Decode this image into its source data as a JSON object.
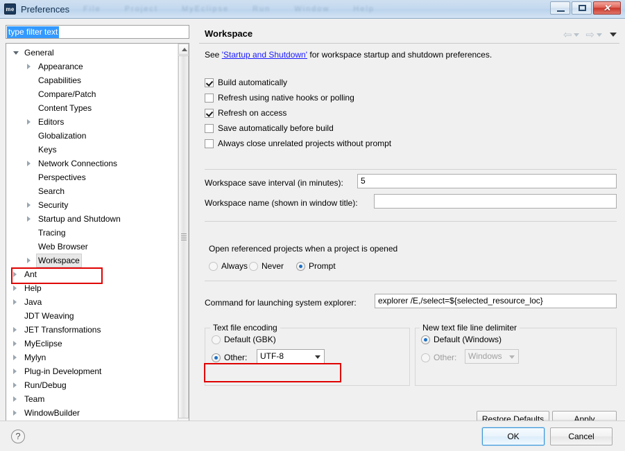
{
  "window": {
    "title": "Preferences",
    "app_icon_text": "me",
    "background_menu_ghost": [
      "File",
      "Project",
      "MyEclipse",
      "Run",
      "Window",
      "Help"
    ],
    "controls": {
      "minimize": "minimize-button",
      "maximize": "maximize-button",
      "close": "✕"
    }
  },
  "filter": {
    "value": "type filter text",
    "placeholder": "type filter text"
  },
  "tree": {
    "items": [
      {
        "label": "General",
        "indent": 0,
        "expander": "open",
        "selected": false
      },
      {
        "label": "Appearance",
        "indent": 1,
        "expander": "closed",
        "selected": false
      },
      {
        "label": "Capabilities",
        "indent": 1,
        "expander": "none",
        "selected": false
      },
      {
        "label": "Compare/Patch",
        "indent": 1,
        "expander": "none",
        "selected": false
      },
      {
        "label": "Content Types",
        "indent": 1,
        "expander": "none",
        "selected": false
      },
      {
        "label": "Editors",
        "indent": 1,
        "expander": "closed",
        "selected": false
      },
      {
        "label": "Globalization",
        "indent": 1,
        "expander": "none",
        "selected": false
      },
      {
        "label": "Keys",
        "indent": 1,
        "expander": "none",
        "selected": false
      },
      {
        "label": "Network Connections",
        "indent": 1,
        "expander": "closed",
        "selected": false
      },
      {
        "label": "Perspectives",
        "indent": 1,
        "expander": "none",
        "selected": false
      },
      {
        "label": "Search",
        "indent": 1,
        "expander": "none",
        "selected": false
      },
      {
        "label": "Security",
        "indent": 1,
        "expander": "closed",
        "selected": false
      },
      {
        "label": "Startup and Shutdown",
        "indent": 1,
        "expander": "closed",
        "selected": false
      },
      {
        "label": "Tracing",
        "indent": 1,
        "expander": "none",
        "selected": false
      },
      {
        "label": "Web Browser",
        "indent": 1,
        "expander": "none",
        "selected": false
      },
      {
        "label": "Workspace",
        "indent": 1,
        "expander": "closed",
        "selected": true
      },
      {
        "label": "Ant",
        "indent": 0,
        "expander": "closed",
        "selected": false
      },
      {
        "label": "Help",
        "indent": 0,
        "expander": "closed",
        "selected": false
      },
      {
        "label": "Java",
        "indent": 0,
        "expander": "closed",
        "selected": false
      },
      {
        "label": "JDT Weaving",
        "indent": 0,
        "expander": "none",
        "selected": false
      },
      {
        "label": "JET Transformations",
        "indent": 0,
        "expander": "closed",
        "selected": false
      },
      {
        "label": "MyEclipse",
        "indent": 0,
        "expander": "closed",
        "selected": false
      },
      {
        "label": "Mylyn",
        "indent": 0,
        "expander": "closed",
        "selected": false
      },
      {
        "label": "Plug-in Development",
        "indent": 0,
        "expander": "closed",
        "selected": false
      },
      {
        "label": "Run/Debug",
        "indent": 0,
        "expander": "closed",
        "selected": false
      },
      {
        "label": "Team",
        "indent": 0,
        "expander": "closed",
        "selected": false
      },
      {
        "label": "WindowBuilder",
        "indent": 0,
        "expander": "closed",
        "selected": false
      }
    ]
  },
  "page": {
    "title": "Workspace",
    "description_prefix": "See ",
    "description_link": "'Startup and Shutdown'",
    "description_suffix": " for workspace startup and shutdown preferences.",
    "checkboxes": [
      {
        "label": "Build automatically",
        "checked": true
      },
      {
        "label": "Refresh using native hooks or polling",
        "checked": false
      },
      {
        "label": "Refresh on access",
        "checked": true
      },
      {
        "label": "Save automatically before build",
        "checked": false
      },
      {
        "label": "Always close unrelated projects without prompt",
        "checked": false
      }
    ],
    "save_interval": {
      "label": "Workspace save interval (in minutes):",
      "value": "5"
    },
    "workspace_name": {
      "label": "Workspace name (shown in window title):",
      "value": ""
    },
    "open_referenced": {
      "title": "Open referenced projects when a project is opened",
      "options": [
        {
          "label": "Always",
          "selected": false
        },
        {
          "label": "Never",
          "selected": false
        },
        {
          "label": "Prompt",
          "selected": true
        }
      ]
    },
    "explorer_command": {
      "label": "Command for launching system explorer:",
      "value": "explorer /E,/select=${selected_resource_loc}"
    },
    "text_file_encoding": {
      "title": "Text file encoding",
      "default_label": "Default (GBK)",
      "default_selected": false,
      "other_label": "Other:",
      "other_selected": true,
      "other_value": "UTF-8"
    },
    "line_delimiter": {
      "title": "New text file line delimiter",
      "default_label": "Default (Windows)",
      "default_selected": true,
      "other_label": "Other:",
      "other_selected": false,
      "other_value": "Windows",
      "other_disabled": true
    },
    "restore_defaults_label": "Restore Defaults",
    "apply_label": "Apply"
  },
  "footer": {
    "help_icon": "?",
    "ok_label": "OK",
    "cancel_label": "Cancel"
  },
  "colors": {
    "accent": "#3399ff",
    "annotation": "#e00000",
    "link": "#1a1aff",
    "ok_border": "#3c95d4"
  }
}
